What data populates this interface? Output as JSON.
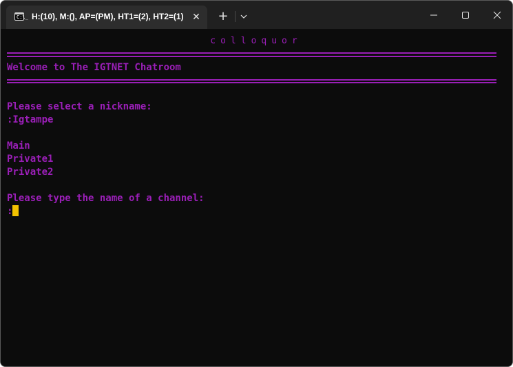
{
  "window": {
    "tab_title": "H:(10), M:(), AP=(PM), HT1=(2), HT2=(1)",
    "tab_icon_glyph": "C:\\_",
    "tab_close_glyph": "✕",
    "new_tab_glyph": "+",
    "icons": [
      "terminal-icon",
      "close-icon",
      "plus-icon",
      "chevron-down-icon",
      "minimize-icon",
      "maximize-icon",
      "window-close-icon"
    ]
  },
  "console": {
    "app_name": "colloquor",
    "welcome": "Welcome to The IGTNET Chatroom",
    "nickname_prompt": "Please select a nickname:",
    "nickname_entry": ":Igtampe",
    "channels": [
      "Main",
      "Private1",
      "Private2"
    ],
    "channel_prompt": "Please type the name of a channel:",
    "input_prefix": ":"
  },
  "colors": {
    "text": "#9b1fb8",
    "cursor": "#f2c200",
    "background": "#0c0c0c",
    "titlebar": "#202020",
    "tab": "#2d2d2d"
  }
}
